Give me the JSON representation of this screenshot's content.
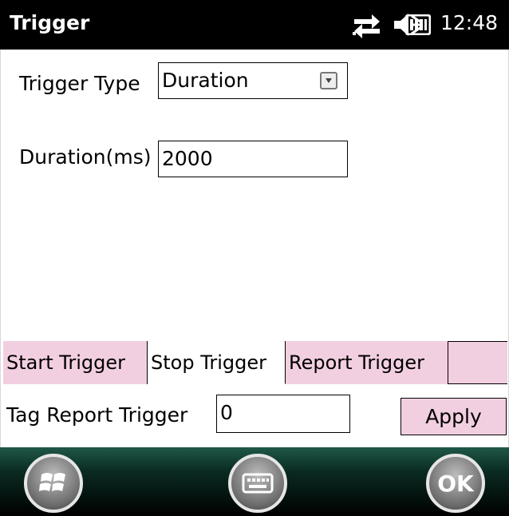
{
  "title": "Trigger",
  "status": {
    "time": "12:48",
    "icons": [
      "sync-arrows-icon",
      "speaker-muted-icon",
      "battery-icon"
    ]
  },
  "form": {
    "trigger_type_label": "Trigger Type",
    "trigger_type_value": "Duration",
    "duration_label": "Duration(ms)",
    "duration_value": "2000"
  },
  "tabs": [
    {
      "label": "Start Trigger",
      "active": false
    },
    {
      "label": "Stop Trigger",
      "active": true
    },
    {
      "label": "Report Trigger",
      "active": false
    }
  ],
  "report": {
    "label": "Tag Report Trigger",
    "value": "0",
    "apply_label": "Apply"
  },
  "softkeys": {
    "ok_label": "OK",
    "left_icon": "windows-start-icon",
    "center_icon": "keyboard-icon"
  },
  "colors": {
    "tab_bg": "#f2cfe0",
    "titlebar_bg": "#000000"
  }
}
